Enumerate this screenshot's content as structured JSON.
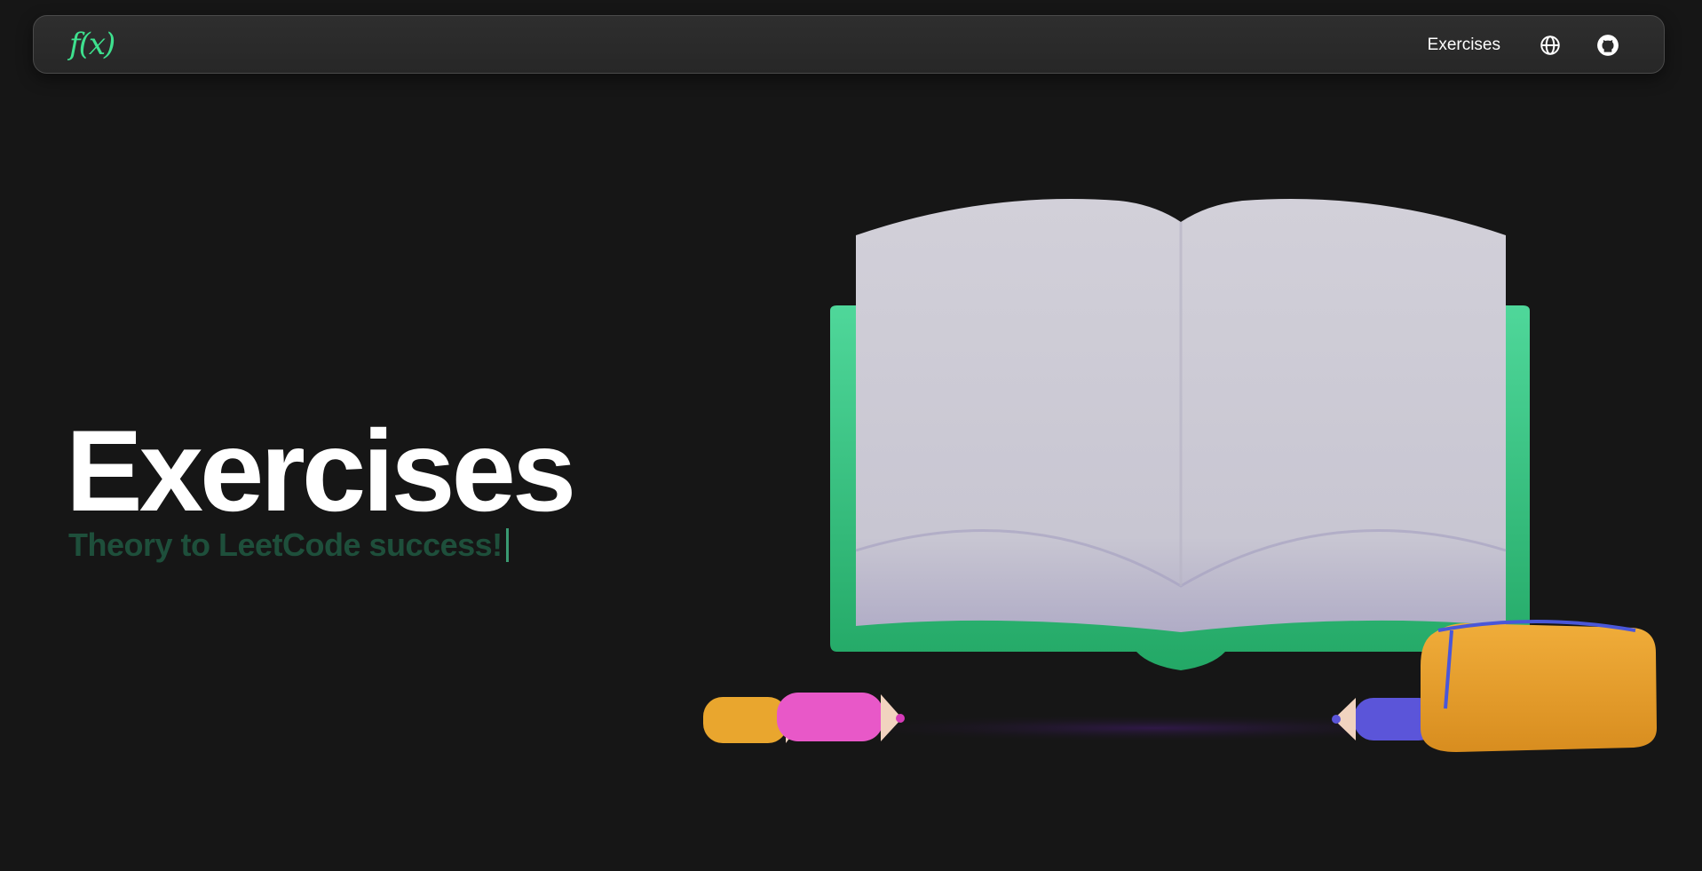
{
  "navbar": {
    "logo": "f(x)",
    "links": [
      {
        "label": "Exercises"
      }
    ],
    "icons": [
      "globe-icon",
      "github-icon"
    ]
  },
  "hero": {
    "title": "Exercises",
    "subtitle": "Theory to LeetCode success!"
  },
  "colors": {
    "background": "#161616",
    "accent": "#3ee08e",
    "subtitle": "#1e4f3b",
    "book_cover": "#2bb673"
  },
  "illustration_items": [
    "open-book",
    "yellow-pencil",
    "pink-pencil",
    "blue-pencil",
    "pencil-case"
  ]
}
